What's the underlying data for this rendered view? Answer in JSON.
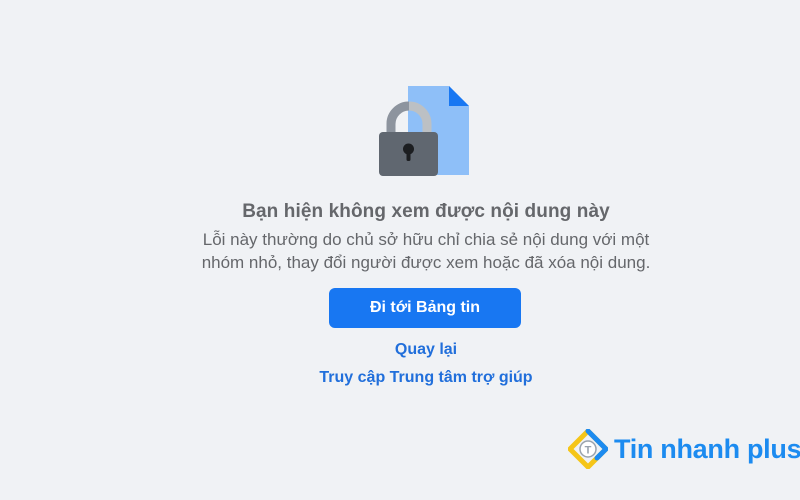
{
  "error": {
    "heading": "Bạn hiện không xem được nội dung này",
    "description_line1": "Lỗi này thường do chủ sở hữu chỉ chia sẻ nội dung với một",
    "description_line2": "nhóm nhỏ, thay đổi người được xem hoặc đã xóa nội dung.",
    "illustration_icon": "locked-document-icon"
  },
  "actions": {
    "primary_label": "Đi tới Bảng tin",
    "back_label": "Quay lại",
    "help_label": "Truy cập Trung tâm trợ giúp"
  },
  "watermark": {
    "text": "Tin nhanh plus",
    "icon": "tin-nhanh-plus-logo"
  },
  "colors": {
    "background": "#f0f2f5",
    "primary_button": "#1877f2",
    "link": "#216fdb",
    "text_secondary": "#65676b",
    "lock_body": "#606770",
    "document": "#8ebff8",
    "watermark": "#1c8bf0"
  }
}
